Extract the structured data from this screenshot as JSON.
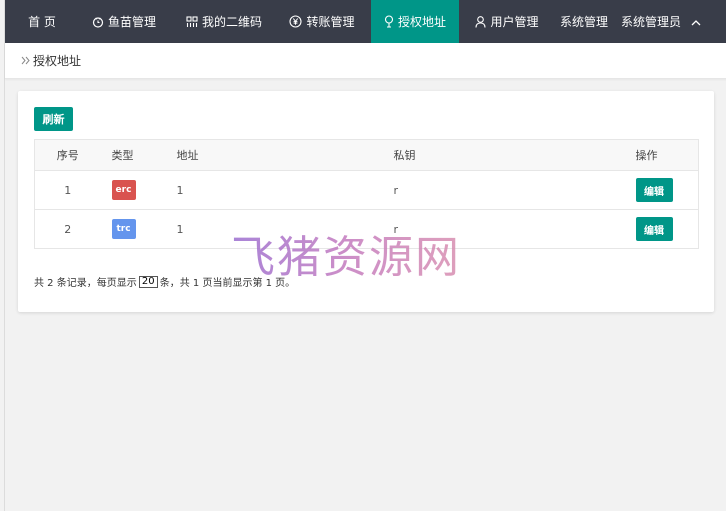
{
  "nav": {
    "items": [
      {
        "label": "首 页",
        "icon": "home"
      },
      {
        "label": "鱼苗管理",
        "icon": "fish-icon"
      },
      {
        "label": "我的二维码",
        "icon": "qrcode-icon"
      },
      {
        "label": "转账管理",
        "icon": "yen-icon"
      },
      {
        "label": "授权地址",
        "icon": "location-pin-icon"
      },
      {
        "label": "用户管理",
        "icon": "user-icon"
      },
      {
        "label": "系统管理",
        "icon": "settings-icon"
      }
    ],
    "active_label": "授权地址",
    "admin_label": "系统管理员",
    "accent": "#009688",
    "background": "#393d49"
  },
  "breadcrumb": {
    "label": "授权地址"
  },
  "toolbar": {
    "refresh_label": "刷新"
  },
  "table": {
    "columns": [
      "序号",
      "类型",
      "地址",
      "私钥",
      "操作"
    ],
    "rows": [
      {
        "index": "1",
        "type": "erc",
        "type_color": "#d9534f",
        "address": "1",
        "key": "r",
        "action": "编辑"
      },
      {
        "index": "2",
        "type": "trc",
        "type_color": "#6495ed",
        "address": "1",
        "key": "r",
        "action": "编辑"
      }
    ]
  },
  "pagination": {
    "prefix": "共 2 条记录，每页显示",
    "page_size": "20",
    "suffix": "条，共 1 页当前显示第 1 页。"
  },
  "watermark": {
    "text": "飞猪资源网"
  }
}
